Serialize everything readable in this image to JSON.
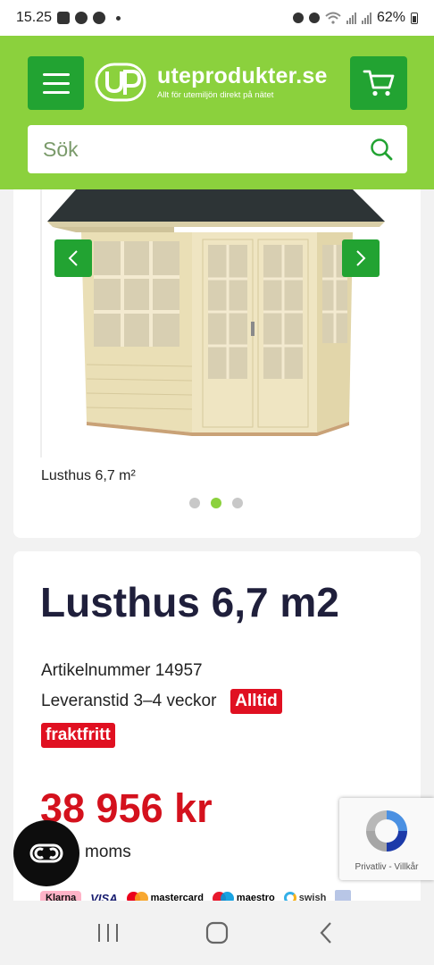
{
  "status_bar": {
    "time": "15.25",
    "battery": "62%"
  },
  "header": {
    "brand": "uteprodukter.se",
    "tagline": "Allt för utemiljön direkt på nätet",
    "search_placeholder": "Sök"
  },
  "gallery": {
    "caption": "Lusthus 6,7 m²",
    "slide_count": 3,
    "active_slide": 2
  },
  "product": {
    "title": "Lusthus 6,7 m2",
    "article_number": "Artikelnummer 14957",
    "delivery_time": "Leveranstid 3–4 veckor",
    "badge_line1": "Alltid",
    "badge_line2": "fraktfritt",
    "price": "38 956 kr",
    "vat_note": "moms"
  },
  "payments": [
    "Klarna",
    "VISA",
    "mastercard",
    "maestro",
    "swish"
  ],
  "recaptcha": {
    "label": "Privatliv - Villkår"
  },
  "colors": {
    "header_green": "#8bd13d",
    "button_green": "#22a332",
    "price_red": "#d4111d",
    "title_navy": "#1f1f3b"
  }
}
